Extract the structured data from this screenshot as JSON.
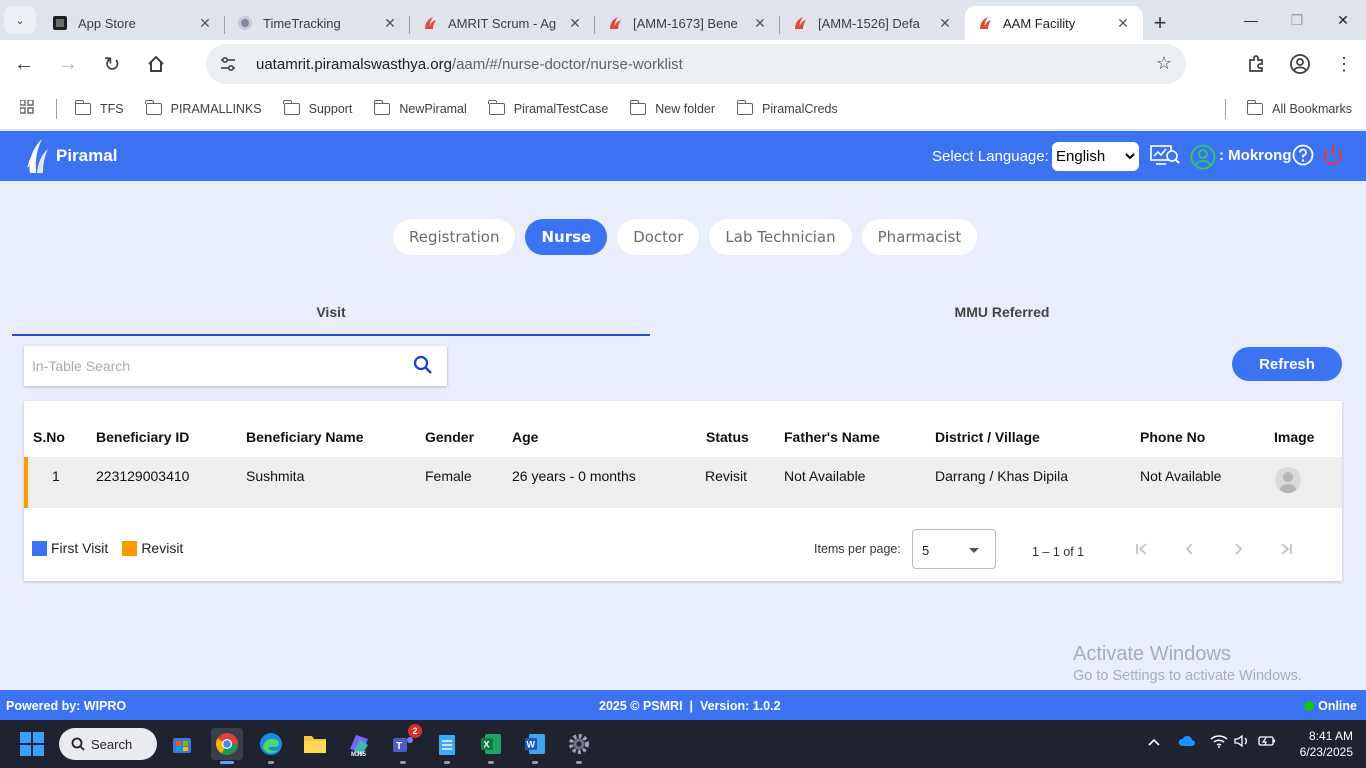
{
  "browser": {
    "tabs": [
      {
        "title": "App Store",
        "favicon": "app-store-icon",
        "active": false
      },
      {
        "title": "TimeTracking",
        "favicon": "timetracking-icon",
        "active": false
      },
      {
        "title": "AMRIT Scrum - Ag",
        "favicon": "piramal-icon",
        "active": false
      },
      {
        "title": "[AMM-1673] Bene",
        "favicon": "piramal-icon",
        "active": false
      },
      {
        "title": "[AMM-1526] Defa",
        "favicon": "piramal-icon",
        "active": false
      },
      {
        "title": "AAM Facility",
        "favicon": "piramal-icon",
        "active": true
      }
    ],
    "url_host": "uatamrit.piramalswasthya.org",
    "url_path": "/aam/#/nurse-doctor/nurse-worklist",
    "bookmarks": [
      "TFS",
      "PIRAMALLINKS",
      "Support",
      "NewPiramal",
      "PiramalTestCase",
      "New folder",
      "PiramalCreds"
    ],
    "all_bookmarks": "All Bookmarks"
  },
  "header": {
    "logo_text": "Piramal",
    "select_language_label": "Select Language:",
    "language_value": "English",
    "user_name": ": Mokrong"
  },
  "roles": [
    "Registration",
    "Nurse",
    "Doctor",
    "Lab Technician",
    "Pharmacist"
  ],
  "active_role": "Nurse",
  "subtabs": {
    "visit": "Visit",
    "mmu": "MMU Referred"
  },
  "search": {
    "placeholder": "In-Table Search"
  },
  "refresh_label": "Refresh",
  "table": {
    "columns": [
      "S.No",
      "Beneficiary ID",
      "Beneficiary Name",
      "Gender",
      "Age",
      "Status",
      "Father's Name",
      "District / Village",
      "Phone No",
      "Image"
    ],
    "rows": [
      {
        "sno": "1",
        "beneficiary_id": "223129003410",
        "name": "Sushmita",
        "gender": "Female",
        "age": "26 years - 0 months",
        "status": "Revisit",
        "father_name": "Not Available",
        "district_village": "Darrang / Khas Dipila",
        "phone": "Not Available"
      }
    ]
  },
  "legend": {
    "first_visit": "First Visit",
    "first_visit_color": "#3c73f3",
    "revisit": "Revisit",
    "revisit_color": "#ff9900"
  },
  "paginator": {
    "items_per_page_label": "Items per page:",
    "items_per_page": "5",
    "range": "1 – 1 of 1"
  },
  "watermark": {
    "line1": "Activate Windows",
    "line2": "Go to Settings to activate Windows."
  },
  "footer": {
    "powered_by": "Powered by: WIPRO",
    "copyright": "2025 © PSMRI  |  Version: 1.0.2",
    "status": "Online"
  },
  "taskbar": {
    "search_label": "Search",
    "teams_badge": "2",
    "time": "8:41 AM",
    "date": "6/23/2025"
  },
  "colors": {
    "primary": "#3c73f3",
    "revisit": "#ff9900",
    "online": "#12c912"
  }
}
